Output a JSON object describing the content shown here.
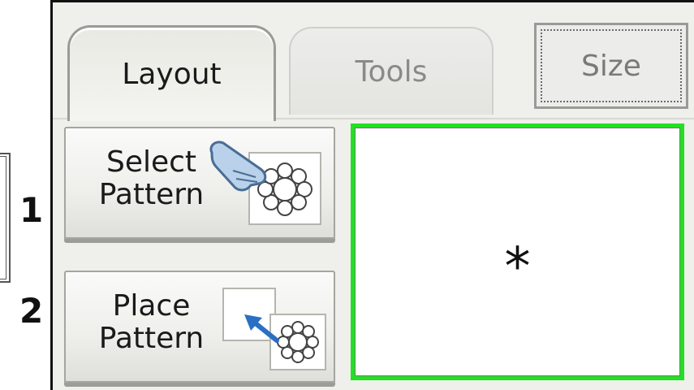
{
  "steps": [
    "1",
    "2"
  ],
  "tabs": [
    {
      "label": "Layout",
      "active": true
    },
    {
      "label": "Tools",
      "active": false
    }
  ],
  "size_button": {
    "label": "Size"
  },
  "select_pattern_button": {
    "line1": "Select",
    "line2": "Pattern"
  },
  "place_pattern_button": {
    "line1": "Place",
    "line2": "Pattern"
  },
  "preview": {
    "marker": "*",
    "border_color": "#22e022"
  },
  "icons": {
    "select": [
      "hand-pointer-icon",
      "flower-pattern-icon"
    ],
    "place": [
      "blue-arrow-icon",
      "flower-pattern-icon"
    ]
  }
}
